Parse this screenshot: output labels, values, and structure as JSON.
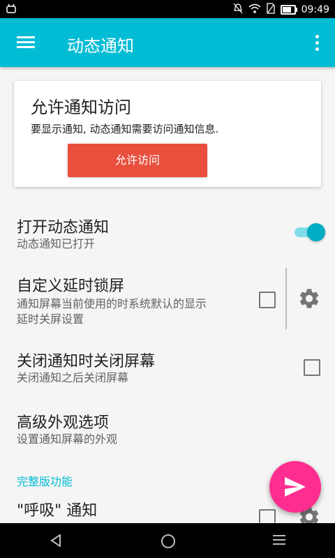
{
  "status_bar": {
    "time": "09:49",
    "icons": [
      "android-icon",
      "mute-icon",
      "wifi-icon",
      "no-sim-icon",
      "battery-icon"
    ]
  },
  "app_bar": {
    "title": "动态通知",
    "menu_icon": "hamburger-menu-icon",
    "more_icon": "more-vert-icon",
    "color": "#00bcd4"
  },
  "permission_card": {
    "title": "允许通知访问",
    "description": "要显示通知, 动态通知需要访问通知信息.",
    "button_label": "允许访问",
    "button_color": "#e84f3d"
  },
  "settings": [
    {
      "title": "打开动态通知",
      "subtitle": "动态通知已打开",
      "control": "toggle",
      "checked": true
    },
    {
      "title": "自定义延时锁屏",
      "subtitle_lines": [
        "通知屏幕当前使用的时系统默认的显示",
        "延时关屏设置"
      ],
      "control": "checkbox",
      "checked": false,
      "extra_icon": "gear-icon"
    },
    {
      "title": "关闭通知时关闭屏幕",
      "subtitle": "关闭通知之后关闭屏幕",
      "control": "checkbox",
      "checked": false
    },
    {
      "title": "高级外观选项",
      "subtitle": "设置通知屏幕的外观"
    }
  ],
  "section_header": "完整版功能",
  "partial_item": {
    "title": "\"呼吸\" 通知",
    "control": "checkbox",
    "extra_icon": "gear-icon"
  },
  "fab": {
    "icon": "send-icon",
    "color": "#ff2d8f"
  },
  "nav_bar": {
    "icons": [
      "back-icon",
      "home-icon",
      "menu-icon"
    ]
  }
}
